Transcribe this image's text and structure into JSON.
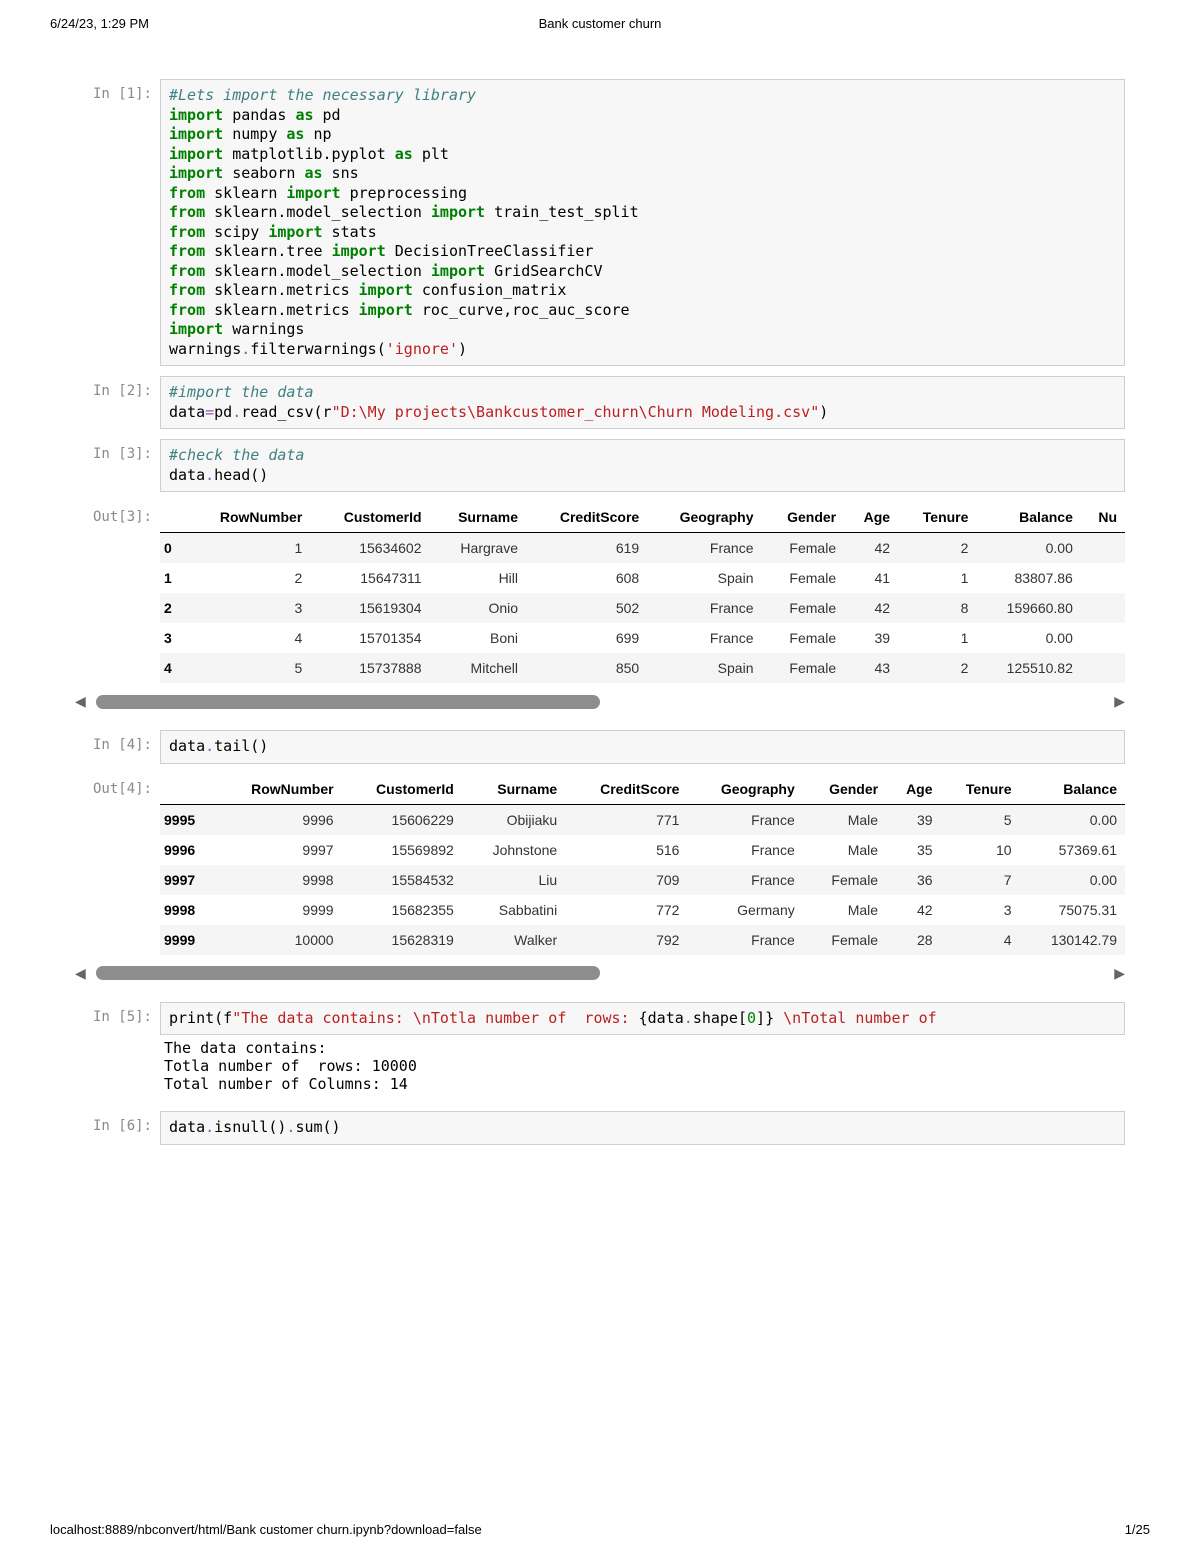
{
  "header": {
    "timestamp": "6/24/23, 1:29 PM",
    "title": "Bank customer churn"
  },
  "footer": {
    "url": "localhost:8889/nbconvert/html/Bank customer churn.ipynb?download=false",
    "page": "1/25"
  },
  "cells": {
    "c1": {
      "prompt": "In [1]:",
      "code": [
        {
          "t": "#Lets import the necessary library",
          "cls": "c-green-it"
        },
        {
          "parts": [
            {
              "t": "import",
              "cls": "c-green-b"
            },
            {
              "t": " pandas "
            },
            {
              "t": "as",
              "cls": "c-green-b"
            },
            {
              "t": " pd"
            }
          ]
        },
        {
          "parts": [
            {
              "t": "import",
              "cls": "c-green-b"
            },
            {
              "t": " numpy "
            },
            {
              "t": "as",
              "cls": "c-green-b"
            },
            {
              "t": " np"
            }
          ]
        },
        {
          "parts": [
            {
              "t": "import",
              "cls": "c-green-b"
            },
            {
              "t": " matplotlib.pyplot "
            },
            {
              "t": "as",
              "cls": "c-green-b"
            },
            {
              "t": " plt"
            }
          ]
        },
        {
          "parts": [
            {
              "t": "import",
              "cls": "c-green-b"
            },
            {
              "t": " seaborn "
            },
            {
              "t": "as",
              "cls": "c-green-b"
            },
            {
              "t": " sns"
            }
          ]
        },
        {
          "parts": [
            {
              "t": "from",
              "cls": "c-green-b"
            },
            {
              "t": " sklearn "
            },
            {
              "t": "import",
              "cls": "c-green-b"
            },
            {
              "t": " preprocessing"
            }
          ]
        },
        {
          "parts": [
            {
              "t": "from",
              "cls": "c-green-b"
            },
            {
              "t": " sklearn.model_selection "
            },
            {
              "t": "import",
              "cls": "c-green-b"
            },
            {
              "t": " train_test_split"
            }
          ]
        },
        {
          "parts": [
            {
              "t": "from",
              "cls": "c-green-b"
            },
            {
              "t": " scipy "
            },
            {
              "t": "import",
              "cls": "c-green-b"
            },
            {
              "t": " stats"
            }
          ]
        },
        {
          "parts": [
            {
              "t": "from",
              "cls": "c-green-b"
            },
            {
              "t": " sklearn.tree "
            },
            {
              "t": "import",
              "cls": "c-green-b"
            },
            {
              "t": " DecisionTreeClassifier"
            }
          ]
        },
        {
          "parts": [
            {
              "t": "from",
              "cls": "c-green-b"
            },
            {
              "t": " sklearn.model_selection "
            },
            {
              "t": "import",
              "cls": "c-green-b"
            },
            {
              "t": " GridSearchCV"
            }
          ]
        },
        {
          "parts": [
            {
              "t": "from",
              "cls": "c-green-b"
            },
            {
              "t": " sklearn.metrics "
            },
            {
              "t": "import",
              "cls": "c-green-b"
            },
            {
              "t": " confusion_matrix"
            }
          ]
        },
        {
          "parts": [
            {
              "t": "from",
              "cls": "c-green-b"
            },
            {
              "t": " sklearn.metrics "
            },
            {
              "t": "import",
              "cls": "c-green-b"
            },
            {
              "t": " roc_curve,roc_auc_score"
            }
          ]
        },
        {
          "parts": [
            {
              "t": "import",
              "cls": "c-green-b"
            },
            {
              "t": " warnings"
            }
          ]
        },
        {
          "parts": [
            {
              "t": "warnings"
            },
            {
              "t": ".",
              "cls": "c-purple"
            },
            {
              "t": "filterwarnings("
            },
            {
              "t": "'ignore'",
              "cls": "c-red"
            },
            {
              "t": ")"
            }
          ]
        }
      ]
    },
    "c2": {
      "prompt": "In [2]:",
      "code": [
        {
          "t": "#import the data",
          "cls": "c-green-it"
        },
        {
          "parts": [
            {
              "t": "data"
            },
            {
              "t": "=",
              "cls": "c-purple"
            },
            {
              "t": "pd"
            },
            {
              "t": ".",
              "cls": "c-purple"
            },
            {
              "t": "read_csv(r"
            },
            {
              "t": "\"D:\\My projects\\Bankcustomer_churn\\Churn Modeling.csv\"",
              "cls": "c-red"
            },
            {
              "t": ")"
            }
          ]
        }
      ]
    },
    "c3": {
      "prompt": "In [3]:",
      "code": [
        {
          "t": "#check the data",
          "cls": "c-green-it"
        },
        {
          "parts": [
            {
              "t": "data"
            },
            {
              "t": ".",
              "cls": "c-purple"
            },
            {
              "t": "head()"
            }
          ]
        }
      ]
    },
    "o3": {
      "prompt": "Out[3]:",
      "columns": [
        "RowNumber",
        "CustomerId",
        "Surname",
        "CreditScore",
        "Geography",
        "Gender",
        "Age",
        "Tenure",
        "Balance",
        "Nu"
      ],
      "index": [
        "0",
        "1",
        "2",
        "3",
        "4"
      ],
      "rows": [
        [
          "1",
          "15634602",
          "Hargrave",
          "619",
          "France",
          "Female",
          "42",
          "2",
          "0.00",
          ""
        ],
        [
          "2",
          "15647311",
          "Hill",
          "608",
          "Spain",
          "Female",
          "41",
          "1",
          "83807.86",
          ""
        ],
        [
          "3",
          "15619304",
          "Onio",
          "502",
          "France",
          "Female",
          "42",
          "8",
          "159660.80",
          ""
        ],
        [
          "4",
          "15701354",
          "Boni",
          "699",
          "France",
          "Female",
          "39",
          "1",
          "0.00",
          ""
        ],
        [
          "5",
          "15737888",
          "Mitchell",
          "850",
          "Spain",
          "Female",
          "43",
          "2",
          "125510.82",
          ""
        ]
      ]
    },
    "c4": {
      "prompt": "In [4]:",
      "code": [
        {
          "parts": [
            {
              "t": "data"
            },
            {
              "t": ".",
              "cls": "c-purple"
            },
            {
              "t": "tail()"
            }
          ]
        }
      ]
    },
    "o4": {
      "prompt": "Out[4]:",
      "columns": [
        "RowNumber",
        "CustomerId",
        "Surname",
        "CreditScore",
        "Geography",
        "Gender",
        "Age",
        "Tenure",
        "Balance"
      ],
      "index": [
        "9995",
        "9996",
        "9997",
        "9998",
        "9999"
      ],
      "rows": [
        [
          "9996",
          "15606229",
          "Obijiaku",
          "771",
          "France",
          "Male",
          "39",
          "5",
          "0.00"
        ],
        [
          "9997",
          "15569892",
          "Johnstone",
          "516",
          "France",
          "Male",
          "35",
          "10",
          "57369.61"
        ],
        [
          "9998",
          "15584532",
          "Liu",
          "709",
          "France",
          "Female",
          "36",
          "7",
          "0.00"
        ],
        [
          "9999",
          "15682355",
          "Sabbatini",
          "772",
          "Germany",
          "Male",
          "42",
          "3",
          "75075.31"
        ],
        [
          "10000",
          "15628319",
          "Walker",
          "792",
          "France",
          "Female",
          "28",
          "4",
          "130142.79"
        ]
      ]
    },
    "c5": {
      "prompt": "In [5]:",
      "code": [
        {
          "parts": [
            {
              "t": "print"
            },
            {
              "t": "(f"
            },
            {
              "t": "\"The data contains: ",
              "cls": "c-red"
            },
            {
              "t": "\\n",
              "cls": "c-red"
            },
            {
              "t": "Totla number of  rows: ",
              "cls": "c-red"
            },
            {
              "t": "{"
            },
            {
              "t": "data"
            },
            {
              "t": ".",
              "cls": "c-purple"
            },
            {
              "t": "shape["
            },
            {
              "t": "0",
              "cls": "c-num"
            },
            {
              "t": "]"
            },
            {
              "t": "}"
            },
            {
              "t": " ",
              "cls": "c-red"
            },
            {
              "t": "\\n",
              "cls": "c-red"
            },
            {
              "t": "Total number of",
              "cls": "c-red"
            }
          ]
        }
      ],
      "stdout": "The data contains: \nTotla number of  rows: 10000\nTotal number of Columns: 14"
    },
    "c6": {
      "prompt": "In [6]:",
      "code": [
        {
          "parts": [
            {
              "t": "data"
            },
            {
              "t": ".",
              "cls": "c-purple"
            },
            {
              "t": "isnull()"
            },
            {
              "t": ".",
              "cls": "c-purple"
            },
            {
              "t": "sum()"
            }
          ]
        }
      ]
    }
  },
  "scroll": {
    "left_arrow": "◀",
    "right_arrow": "▶"
  }
}
